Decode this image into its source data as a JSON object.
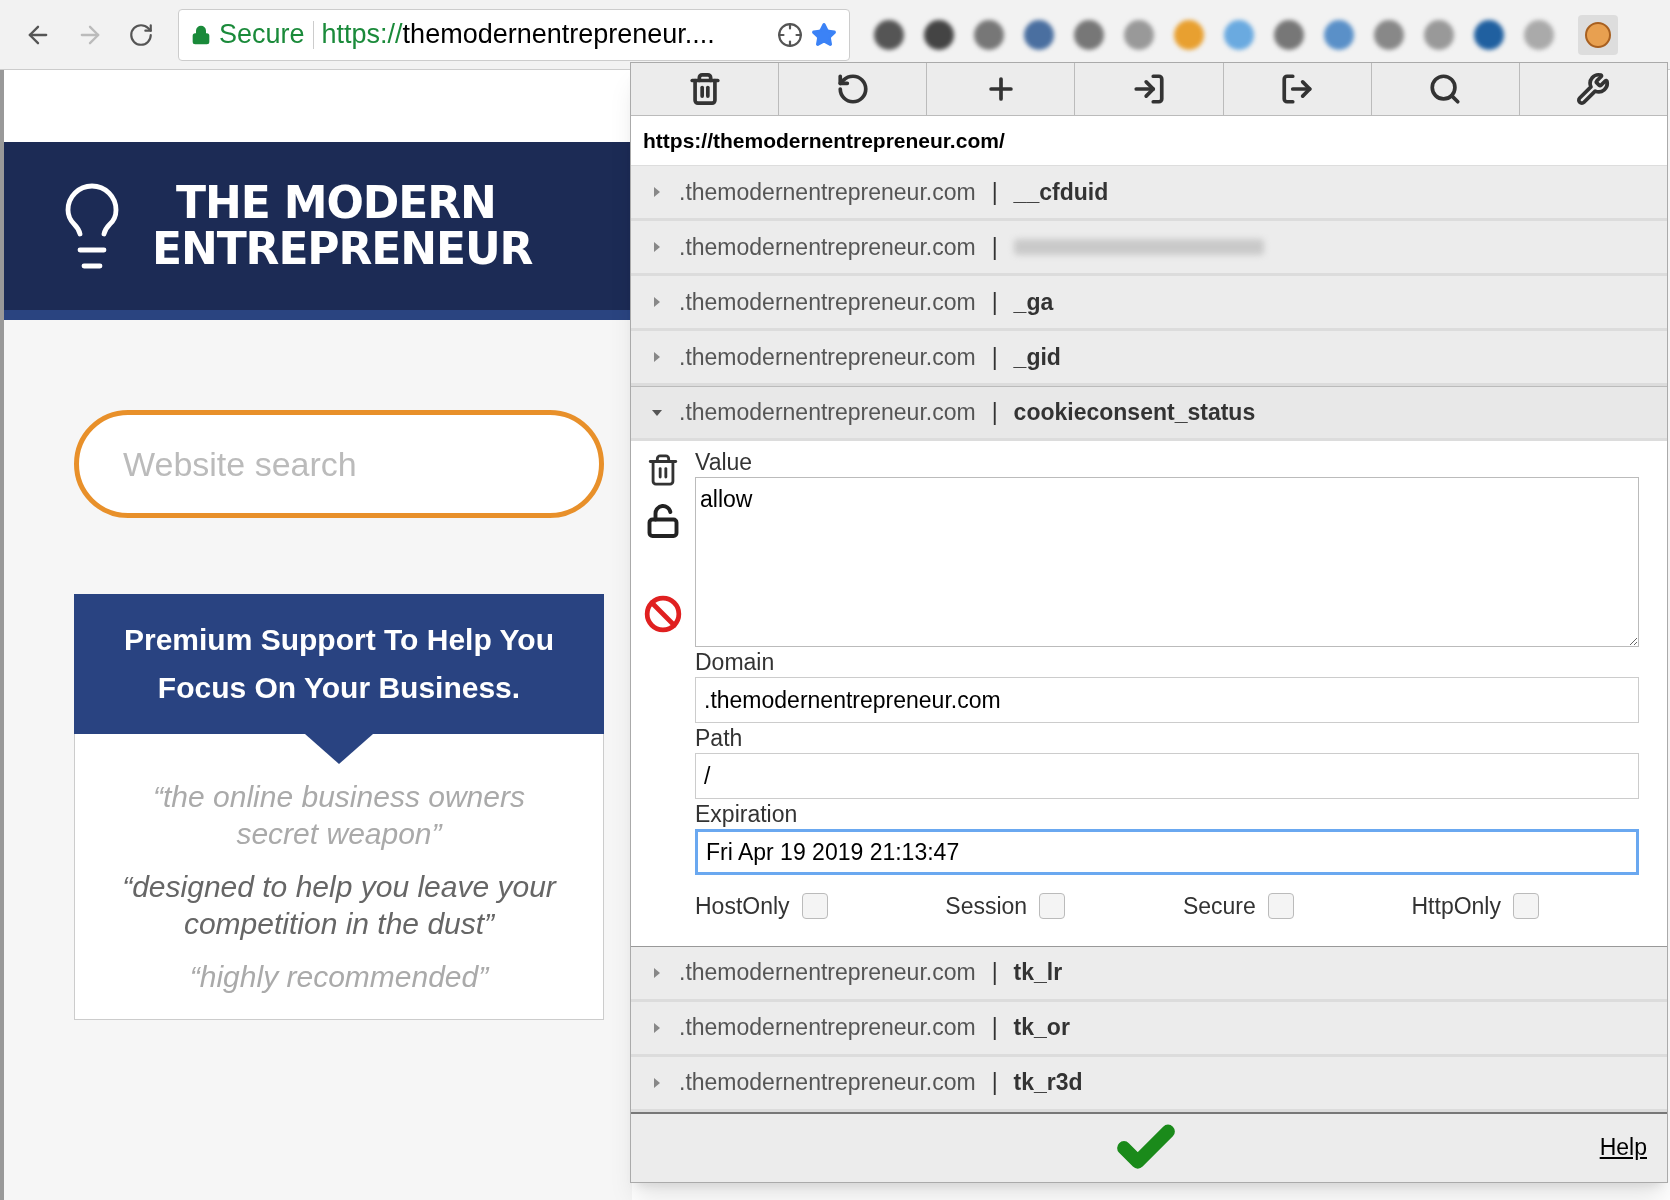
{
  "browser": {
    "secure_label": "Secure",
    "url_scheme": "https://",
    "url_rest": "themodernentrepreneur....",
    "bookmarked": true
  },
  "page": {
    "logo_lines": [
      "THE MODERN",
      "ENTREPRENEUR"
    ],
    "search_placeholder": "Website search",
    "promo_title": "Premium Support To Help You Focus On Your Business.",
    "quotes": [
      {
        "text": "“the online business owners secret weapon”",
        "emphasis": false
      },
      {
        "text": "“designed to help you leave your competition in the dust”",
        "emphasis": true
      },
      {
        "text": "“highly recommended”",
        "emphasis": false
      }
    ]
  },
  "popup": {
    "toolbar": [
      {
        "kind": "delete"
      },
      {
        "kind": "reset"
      },
      {
        "kind": "add"
      },
      {
        "kind": "import"
      },
      {
        "kind": "export"
      },
      {
        "kind": "search"
      },
      {
        "kind": "settings"
      }
    ],
    "url": "https://themodernentrepreneur.com/",
    "cookies": [
      {
        "domain": ".themodernentrepreneur.com",
        "separator": "|",
        "name": "__cfduid",
        "blurred": false,
        "expanded": false
      },
      {
        "domain": ".themodernentrepreneur.com",
        "separator": "|",
        "blurred": true,
        "expanded": false
      },
      {
        "domain": ".themodernentrepreneur.com",
        "separator": "|",
        "name": "_ga",
        "blurred": false,
        "expanded": false
      },
      {
        "domain": ".themodernentrepreneur.com",
        "separator": "|",
        "name": "_gid",
        "blurred": false,
        "expanded": false
      },
      {
        "domain": ".themodernentrepreneur.com",
        "separator": "|",
        "name": "cookieconsent_status",
        "blurred": false,
        "expanded": true
      },
      {
        "domain": ".themodernentrepreneur.com",
        "separator": "|",
        "name": "tk_lr",
        "blurred": false,
        "expanded": false
      },
      {
        "domain": ".themodernentrepreneur.com",
        "separator": "|",
        "name": "tk_or",
        "blurred": false,
        "expanded": false
      },
      {
        "domain": ".themodernentrepreneur.com",
        "separator": "|",
        "name": "tk_r3d",
        "blurred": false,
        "expanded": false
      }
    ],
    "detail": {
      "fields": [
        {
          "label": "Value",
          "kind": "textarea",
          "value": "allow",
          "focused": false
        },
        {
          "label": "Domain",
          "kind": "input",
          "value": ".themodernentrepreneur.com",
          "focused": false
        },
        {
          "label": "Path",
          "kind": "input",
          "value": "/",
          "focused": false
        },
        {
          "label": "Expiration",
          "kind": "input",
          "value": "Fri Apr 19 2019 21:13:47",
          "focused": true
        }
      ],
      "flags": [
        {
          "label": "HostOnly",
          "checked": false
        },
        {
          "label": "Session",
          "checked": false
        },
        {
          "label": "Secure",
          "checked": false
        },
        {
          "label": "HttpOnly",
          "checked": false
        }
      ]
    },
    "help": "Help"
  }
}
